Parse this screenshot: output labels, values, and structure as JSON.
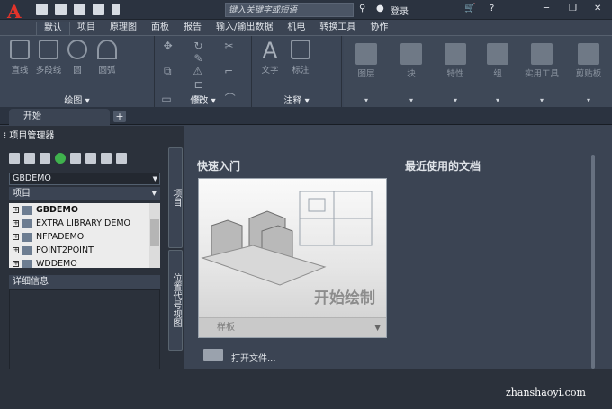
{
  "app": {
    "logo": "A",
    "login_label": "登录"
  },
  "search": {
    "placeholder": "键入关键字或短语"
  },
  "ribbon_tabs": [
    "默认",
    "项目",
    "原理图",
    "面板",
    "报告",
    "输入/输出数据",
    "机电",
    "转换工具",
    "协作"
  ],
  "panels": {
    "draw": {
      "title": "绘图",
      "tools": [
        "直线",
        "多段线",
        "圆",
        "圆弧"
      ]
    },
    "modify": {
      "title": "修改"
    },
    "annotate": {
      "title": "注释",
      "tools": [
        "文字",
        "标注"
      ]
    },
    "ghost": [
      "图层",
      "块",
      "特性",
      "组",
      "实用工具",
      "剪贴板"
    ]
  },
  "doc_tabs": {
    "start": "开始",
    "add": "+"
  },
  "project_manager": {
    "title": "项目管理器",
    "combo_value": "GBDEMO",
    "section_header": "项目",
    "items": [
      {
        "label": "GBDEMO",
        "bold": true
      },
      {
        "label": "EXTRA LIBRARY DEMO",
        "bold": false
      },
      {
        "label": "NFPADEMO",
        "bold": false
      },
      {
        "label": "POINT2POINT",
        "bold": false
      },
      {
        "label": "WDDEMO",
        "bold": false
      }
    ],
    "detail_header": "详细信息",
    "side_tabs": [
      "项目",
      "位置代号视图"
    ]
  },
  "start": {
    "quick_start": "快速入门",
    "recent_docs": "最近使用的文档",
    "start_drawing": "开始绘制",
    "template": "样板",
    "open_files": "打开文件..."
  },
  "watermark": "zhanshaoyi.com",
  "colors": {
    "accent": "#e2332a",
    "ribbon_bg": "#3c4656",
    "panel_bg": "#2b313b"
  }
}
